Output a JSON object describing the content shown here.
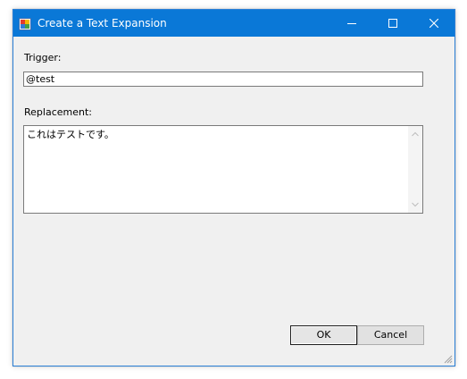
{
  "window": {
    "title": "Create a Text Expansion",
    "app_icon": "app-window-icon",
    "controls": {
      "minimize_icon": "minimize-icon",
      "maximize_icon": "maximize-icon",
      "close_icon": "close-icon"
    }
  },
  "form": {
    "trigger_label": "Trigger:",
    "trigger_value": "@test",
    "replacement_label": "Replacement:",
    "replacement_value": "これはテストです。"
  },
  "buttons": {
    "ok_label": "OK",
    "cancel_label": "Cancel"
  },
  "colors": {
    "titlebar": "#0a78d7",
    "dialog_background": "#f0f0f0"
  }
}
